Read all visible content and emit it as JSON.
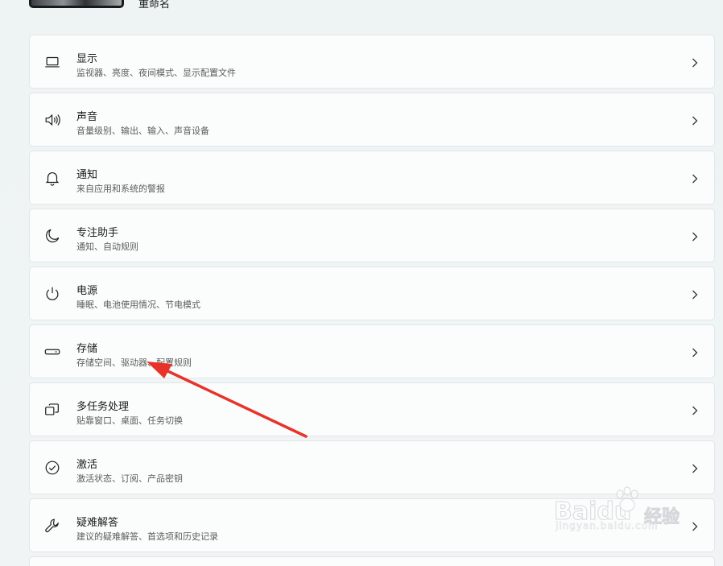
{
  "header": {
    "rename_label": "重命名"
  },
  "settings_items": [
    {
      "key": "display",
      "title": "显示",
      "desc": "监视器、亮度、夜间模式、显示配置文件",
      "icon": "monitor-icon"
    },
    {
      "key": "sound",
      "title": "声音",
      "desc": "音量级别、输出、输入、声音设备",
      "icon": "speaker-icon"
    },
    {
      "key": "notifications",
      "title": "通知",
      "desc": "来自应用和系统的警报",
      "icon": "bell-icon"
    },
    {
      "key": "focus-assist",
      "title": "专注助手",
      "desc": "通知、自动规则",
      "icon": "moon-icon"
    },
    {
      "key": "power",
      "title": "电源",
      "desc": "睡眠、电池使用情况、节电模式",
      "icon": "power-icon"
    },
    {
      "key": "storage",
      "title": "存储",
      "desc": "存储空间、驱动器、配置规则",
      "icon": "drive-icon"
    },
    {
      "key": "multitasking",
      "title": "多任务处理",
      "desc": "贴靠窗口、桌面、任务切换",
      "icon": "windows-stack-icon"
    },
    {
      "key": "activation",
      "title": "激活",
      "desc": "激活状态、订阅、产品密钥",
      "icon": "check-circle-icon"
    },
    {
      "key": "troubleshoot",
      "title": "疑难解答",
      "desc": "建议的疑难解答、首选项和历史记录",
      "icon": "wrench-icon"
    }
  ],
  "annotation": {
    "color": "#e8332a"
  },
  "watermark": {
    "brand": "Baidu",
    "jingyan": "经验",
    "url": "jingyan.baidu.com"
  }
}
